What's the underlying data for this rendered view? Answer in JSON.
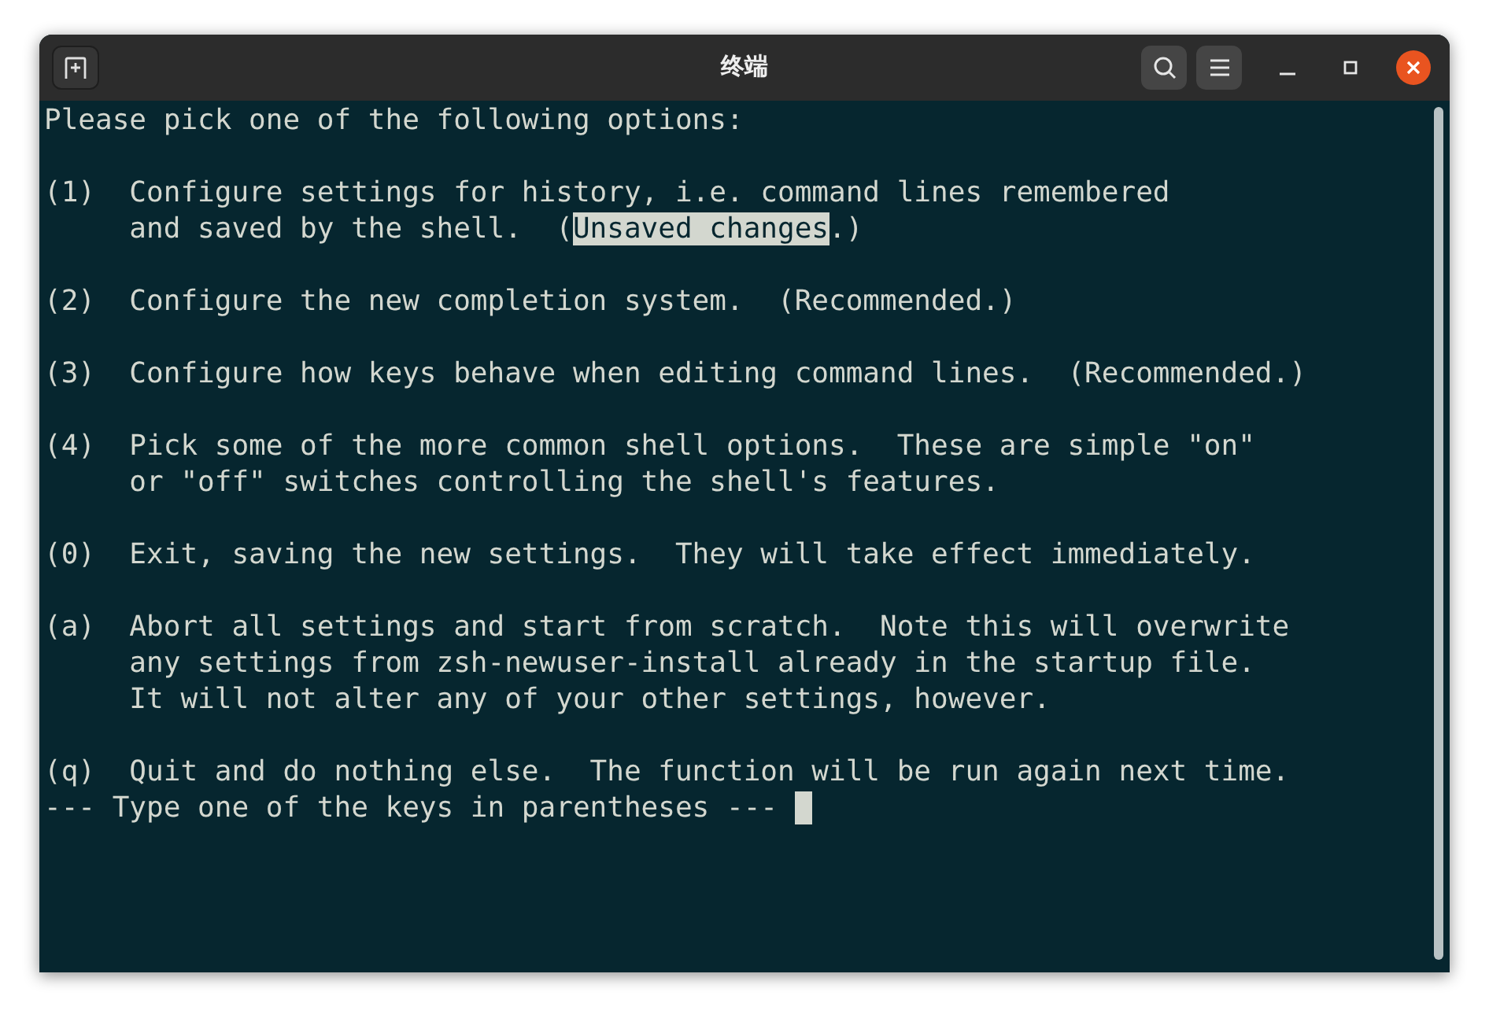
{
  "window": {
    "title": "终端"
  },
  "terminal": {
    "cursor_visible": true,
    "blocks": [
      {
        "lines": [
          {
            "segments": [
              {
                "text": "Please pick one of the following options:",
                "highlighted": false
              }
            ]
          }
        ]
      },
      {
        "lines": [
          {
            "segments": [
              {
                "text": "(1)  Configure settings for history, i.e. command lines remembered",
                "highlighted": false
              }
            ]
          },
          {
            "segments": [
              {
                "text": "     and saved by the shell.  (",
                "highlighted": false
              },
              {
                "text": "Unsaved changes",
                "highlighted": true
              },
              {
                "text": ".)",
                "highlighted": false
              }
            ]
          }
        ]
      },
      {
        "lines": [
          {
            "segments": [
              {
                "text": "(2)  Configure the new completion system.  (Recommended.)",
                "highlighted": false
              }
            ]
          }
        ]
      },
      {
        "lines": [
          {
            "segments": [
              {
                "text": "(3)  Configure how keys behave when editing command lines.  (Recommended.)",
                "highlighted": false
              }
            ]
          }
        ]
      },
      {
        "lines": [
          {
            "segments": [
              {
                "text": "(4)  Pick some of the more common shell options.  These are simple \"on\"",
                "highlighted": false
              }
            ]
          },
          {
            "segments": [
              {
                "text": "     or \"off\" switches controlling the shell's features.",
                "highlighted": false
              }
            ]
          }
        ]
      },
      {
        "lines": [
          {
            "segments": [
              {
                "text": "(0)  Exit, saving the new settings.  They will take effect immediately.",
                "highlighted": false
              }
            ]
          }
        ]
      },
      {
        "lines": [
          {
            "segments": [
              {
                "text": "(a)  Abort all settings and start from scratch.  Note this will overwrite",
                "highlighted": false
              }
            ]
          },
          {
            "segments": [
              {
                "text": "     any settings from zsh-newuser-install already in the startup file.",
                "highlighted": false
              }
            ]
          },
          {
            "segments": [
              {
                "text": "     It will not alter any of your other settings, however.",
                "highlighted": false
              }
            ]
          }
        ]
      },
      {
        "lines": [
          {
            "segments": [
              {
                "text": "(q)  Quit and do nothing else.  The function will be run again next time.",
                "highlighted": false
              }
            ]
          },
          {
            "segments": [
              {
                "text": "--- Type one of the keys in parentheses --- ",
                "highlighted": false
              }
            ]
          }
        ]
      }
    ]
  }
}
